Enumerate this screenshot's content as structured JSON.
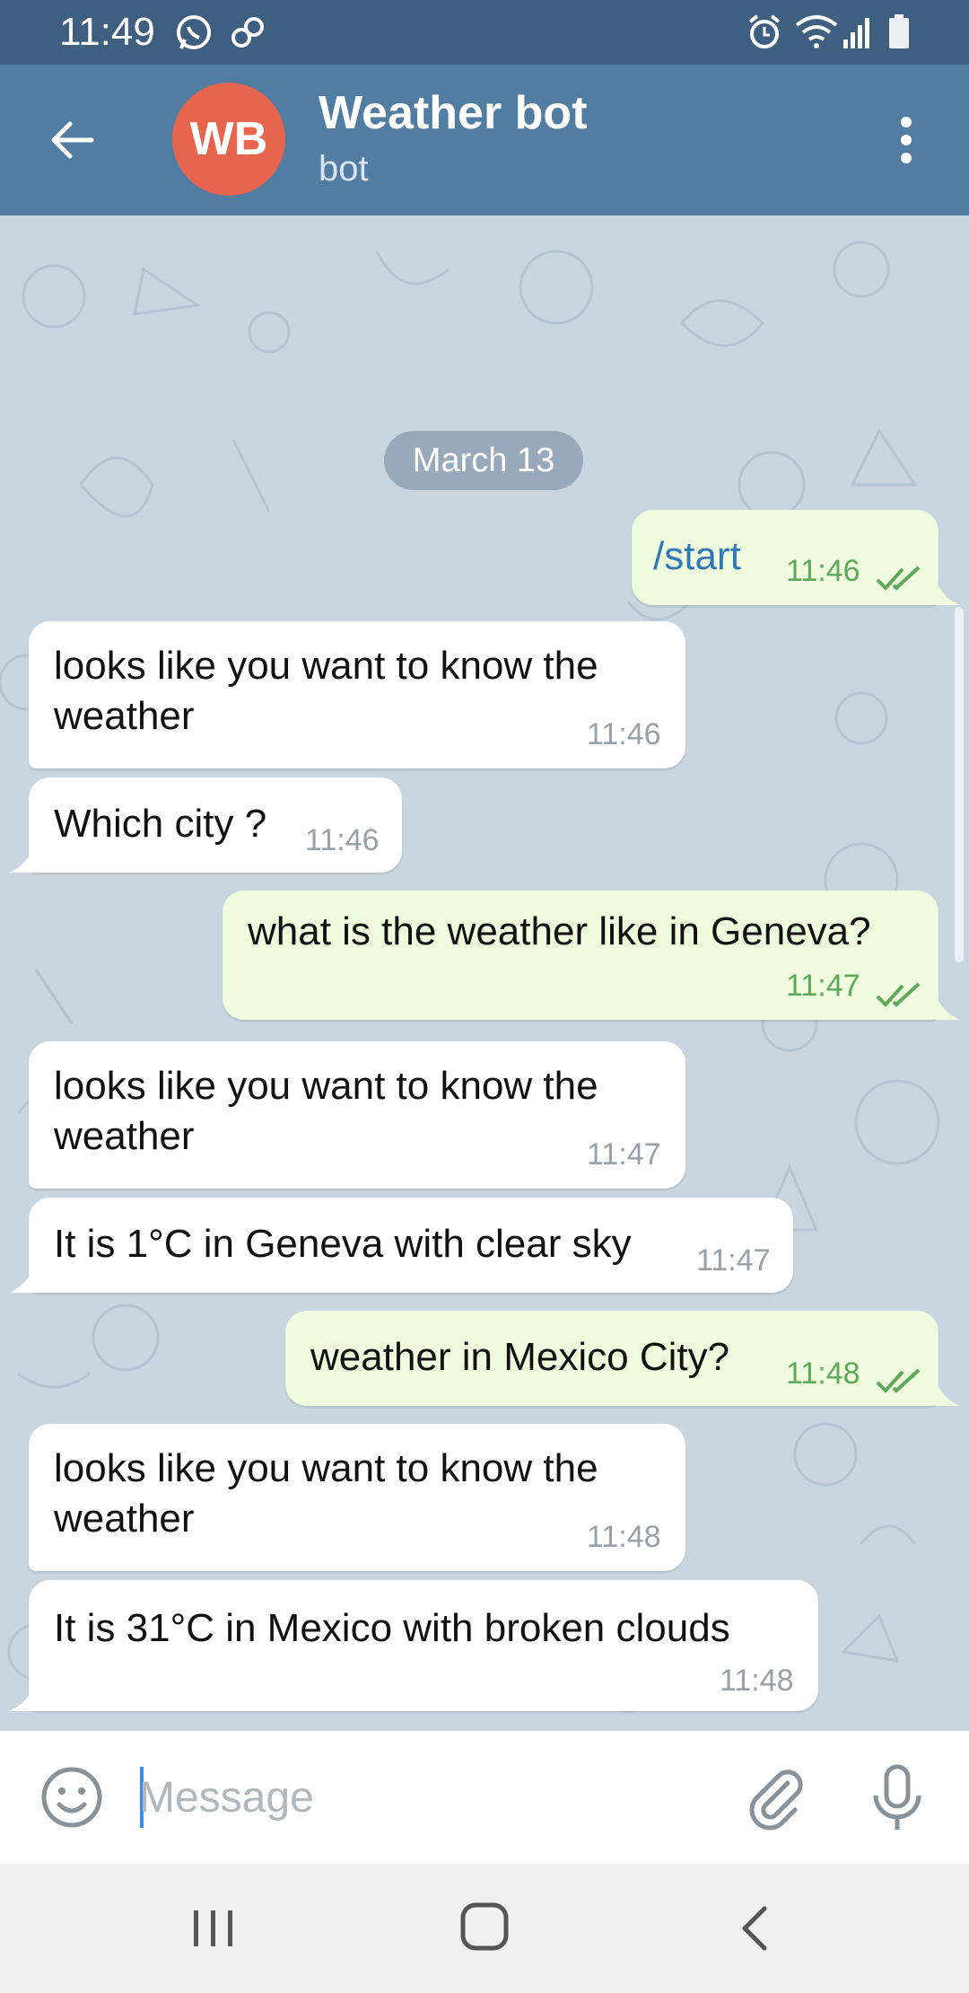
{
  "status_bar": {
    "time": "11:49",
    "icons": [
      "whatsapp-icon",
      "link-icon",
      "alarm-icon",
      "wifi-icon",
      "signal-icon",
      "battery-icon"
    ]
  },
  "header": {
    "avatar_initials": "WB",
    "avatar_color": "#e6654f",
    "title": "Weather bot",
    "subtitle": "bot",
    "background": "#527da3"
  },
  "chat": {
    "date_label": "March 13",
    "messages": [
      {
        "direction": "out",
        "text": "/start",
        "time": "11:46",
        "read": true
      },
      {
        "direction": "in",
        "text_line1": "looks like you want to know the",
        "text_line2": "weather",
        "time": "11:46"
      },
      {
        "direction": "in",
        "text": "Which city ?",
        "time": "11:46"
      },
      {
        "direction": "out",
        "text": "what is the weather like in Geneva?",
        "time": "11:47",
        "read": true
      },
      {
        "direction": "in",
        "text_line1": "looks like you want to know the",
        "text_line2": "weather",
        "time": "11:47"
      },
      {
        "direction": "in",
        "text": "It is 1°C in Geneva with clear sky",
        "time": "11:47"
      },
      {
        "direction": "out",
        "text": "weather in Mexico City?",
        "time": "11:48",
        "read": true
      },
      {
        "direction": "in",
        "text_line1": "looks like you want to know the",
        "text_line2": "weather",
        "time": "11:48"
      },
      {
        "direction": "in",
        "text": "It is 31°C in Mexico with broken clouds",
        "time": "11:48"
      }
    ]
  },
  "input": {
    "placeholder": "Message",
    "value": ""
  },
  "colors": {
    "incoming_bubble": "#ffffff",
    "outgoing_bubble": "#effdde",
    "outgoing_time": "#5fa85b",
    "command_link": "#2f79b8"
  }
}
